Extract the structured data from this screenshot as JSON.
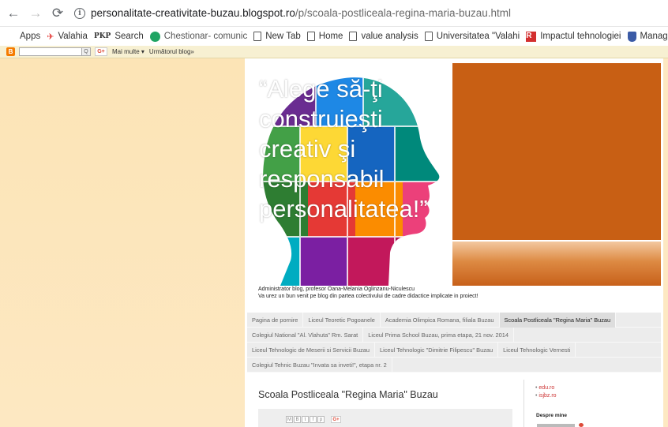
{
  "browser": {
    "back_icon": "←",
    "forward_icon": "→",
    "reload_icon": "C",
    "info_icon": "i",
    "url_host": "personalitate-creativitate-buzau.blogspot.ro",
    "url_path": "/p/scoala-postliceala-regina-maria-buzau.html"
  },
  "bookmarks": [
    {
      "label": "Apps",
      "icon": "apps-grid-icon"
    },
    {
      "label": "Valahia",
      "icon": "pin-icon"
    },
    {
      "label": "Search",
      "icon": "pkp-icon",
      "icon_text": "PKP"
    },
    {
      "label": "Chestionar- comunic",
      "icon": "green-circle-icon"
    },
    {
      "label": "New Tab",
      "icon": "page-icon"
    },
    {
      "label": "Home",
      "icon": "page-icon"
    },
    {
      "label": "value analysis",
      "icon": "page-icon"
    },
    {
      "label": "Universitatea \"Valahi",
      "icon": "page-icon"
    },
    {
      "label": "Impactul tehnologiei",
      "icon": "r-icon",
      "icon_text": "R"
    },
    {
      "label": "Manager",
      "icon": "shield-icon"
    }
  ],
  "navbar": {
    "blogger_logo": "B",
    "search_btn": "Q",
    "gplus": "G+",
    "more": "Mai multe ▾",
    "next_blog": "Următorul blog»"
  },
  "header": {
    "quote": "“Alege să-ţi construieşti creativ şi responsabil personalitatea!”"
  },
  "admin": {
    "line1": "Administrator blog, profesor Oana-Melania Oglinzanu-Niculescu",
    "line2": "Va urez un bun venit pe blog din partea colectivului de cadre didactice implicate in proiect!"
  },
  "tabs": [
    [
      {
        "label": "Pagina de pornire",
        "active": false
      },
      {
        "label": "Liceul Teoretic Pogoanele",
        "active": false
      },
      {
        "label": "Academia Olimpica Romana, filiala Buzau",
        "active": false
      },
      {
        "label": "Scoala Postliceala \"Regina Maria\" Buzau",
        "active": true
      }
    ],
    [
      {
        "label": "Colegiul National \"Al. Vlahuta\" Rm. Sarat",
        "active": false
      },
      {
        "label": "Liceul Prima School Buzau, prima etapa, 21 nov. 2014",
        "active": false
      }
    ],
    [
      {
        "label": "Liceul Tehnologic de Meserii si Servicii Buzau",
        "active": false
      },
      {
        "label": "Liceul Tehnologic \"Dimitrie Filipescu\" Buzau",
        "active": false
      },
      {
        "label": "Liceul Tehnologic Vernesti",
        "active": false
      }
    ],
    [
      {
        "label": "Colegiul Tehnic Buzau \"Invata sa inveti!\", etapa nr. 2",
        "active": false
      }
    ]
  ],
  "post": {
    "title": "Scoala Postliceala \"Regina Maria\" Buzau",
    "share_gplus": "G+"
  },
  "sidebar": {
    "links": [
      "edu.ro",
      "isjbz.ro"
    ],
    "about_heading": "Despre mine"
  }
}
